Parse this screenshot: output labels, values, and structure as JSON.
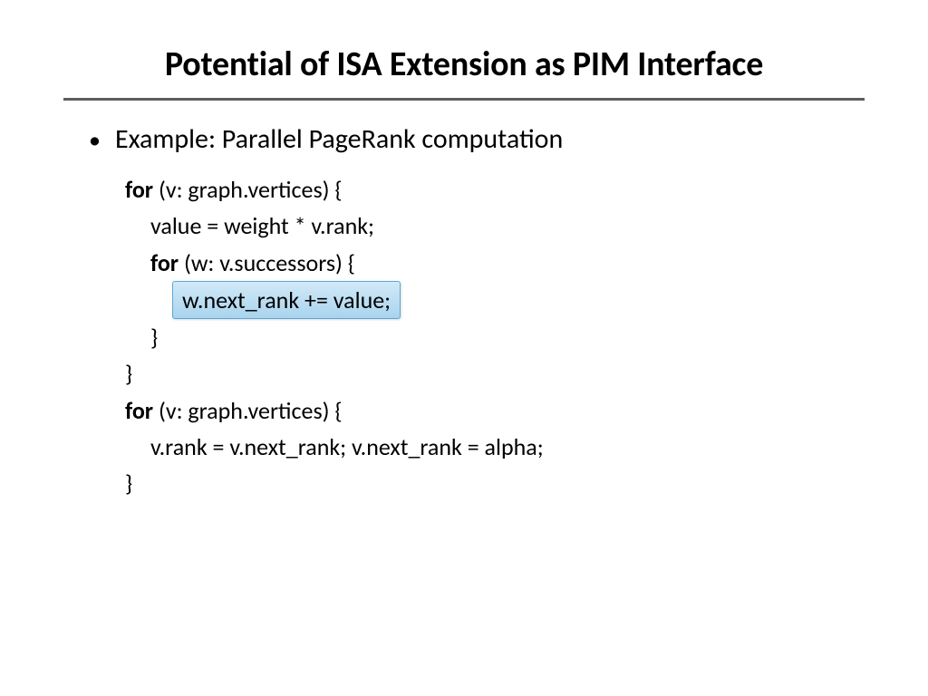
{
  "title": "Potential of ISA Extension as PIM Interface",
  "bullet": "Example: Parallel PageRank computation",
  "code": {
    "l1_kw": "for",
    "l1_rest": " (v: graph.vertices) {",
    "l2": "value = weight * v.rank;",
    "l3_kw": "for",
    "l3_rest": " (w: v.successors) {",
    "l4": "w.next_rank += value;",
    "l5": "}",
    "l6": "}",
    "l7_kw": "for",
    "l7_rest": " (v: graph.vertices) {",
    "l8": "v.rank = v.next_rank; v.next_rank = alpha;",
    "l9": "}"
  }
}
